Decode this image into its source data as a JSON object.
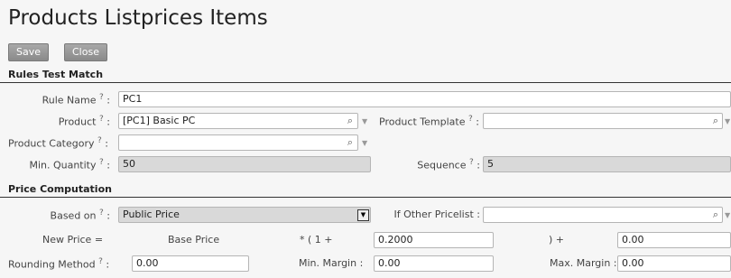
{
  "page": {
    "title": "Products Listprices Items"
  },
  "toolbar": {
    "save_label": "Save",
    "close_label": "Close"
  },
  "sections": {
    "rules": "Rules Test Match",
    "price": "Price Computation"
  },
  "help_mark": "?",
  "colon": ":",
  "fields": {
    "rule_name": {
      "label": "Rule Name",
      "value": "PC1"
    },
    "product": {
      "label": "Product",
      "value": "[PC1] Basic PC"
    },
    "product_template": {
      "label": "Product Template",
      "value": ""
    },
    "product_category": {
      "label": "Product Category",
      "value": ""
    },
    "min_quantity": {
      "label": "Min. Quantity",
      "value": "50"
    },
    "sequence": {
      "label": "Sequence",
      "value": "5"
    },
    "based_on": {
      "label": "Based on",
      "value": "Public Price"
    },
    "other_pricelist": {
      "label": "If Other Pricelist :",
      "value": ""
    },
    "formula": {
      "new_price": "New Price =",
      "base_price": "Base Price",
      "times_one_plus": "* ( 1 +",
      "discount": "0.2000",
      "close_plus": ") +",
      "surcharge": "0.00"
    },
    "rounding": {
      "label": "Rounding Method",
      "value": "0.00"
    },
    "min_margin": {
      "label": "Min. Margin :",
      "value": "0.00"
    },
    "max_margin": {
      "label": "Max. Margin :",
      "value": "0.00"
    }
  },
  "icons": {
    "search": "search-icon",
    "dropdown": "dropdown-arrow-icon",
    "select": "select-arrow-icon"
  }
}
